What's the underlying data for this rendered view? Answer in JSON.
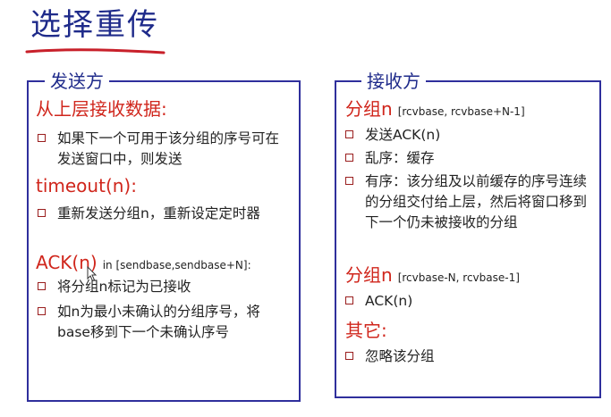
{
  "title": "选择重传",
  "sender": {
    "heading": "发送方",
    "sections": [
      {
        "head": "从上层接收数据:",
        "range": "",
        "bullets": [
          "如果下一个可用于该分组的序号可在发送窗口中，则发送"
        ]
      },
      {
        "head": "timeout(n):",
        "range": "",
        "bullets": [
          "重新发送分组n，重新设定定时器"
        ]
      },
      {
        "head": "ACK(n)",
        "range": "in [sendbase,sendbase+N]:",
        "bullets": [
          "将分组n标记为已接收",
          "如n为最小未确认的分组序号，将base移到下一个未确认序号"
        ]
      }
    ]
  },
  "receiver": {
    "heading": "接收方",
    "sections": [
      {
        "head": "分组n",
        "range": "[rcvbase, rcvbase+N-1]",
        "bullets": [
          "发送ACK(n)",
          "乱序：缓存",
          "有序：该分组及以前缓存的序号连续的分组交付给上层，然后将窗口移到下一个仍未被接收的分组"
        ]
      },
      {
        "head": "分组n",
        "range": "[rcvbase-N, rcvbase-1]",
        "bullets": [
          "ACK(n)"
        ]
      },
      {
        "head": "其它:",
        "range": "",
        "bullets": [
          "忽略该分组"
        ]
      }
    ]
  },
  "colors": {
    "title": "#1e2a8a",
    "border": "#2f2f9c",
    "heading_red": "#d0261c",
    "underline": "#c8202a"
  }
}
